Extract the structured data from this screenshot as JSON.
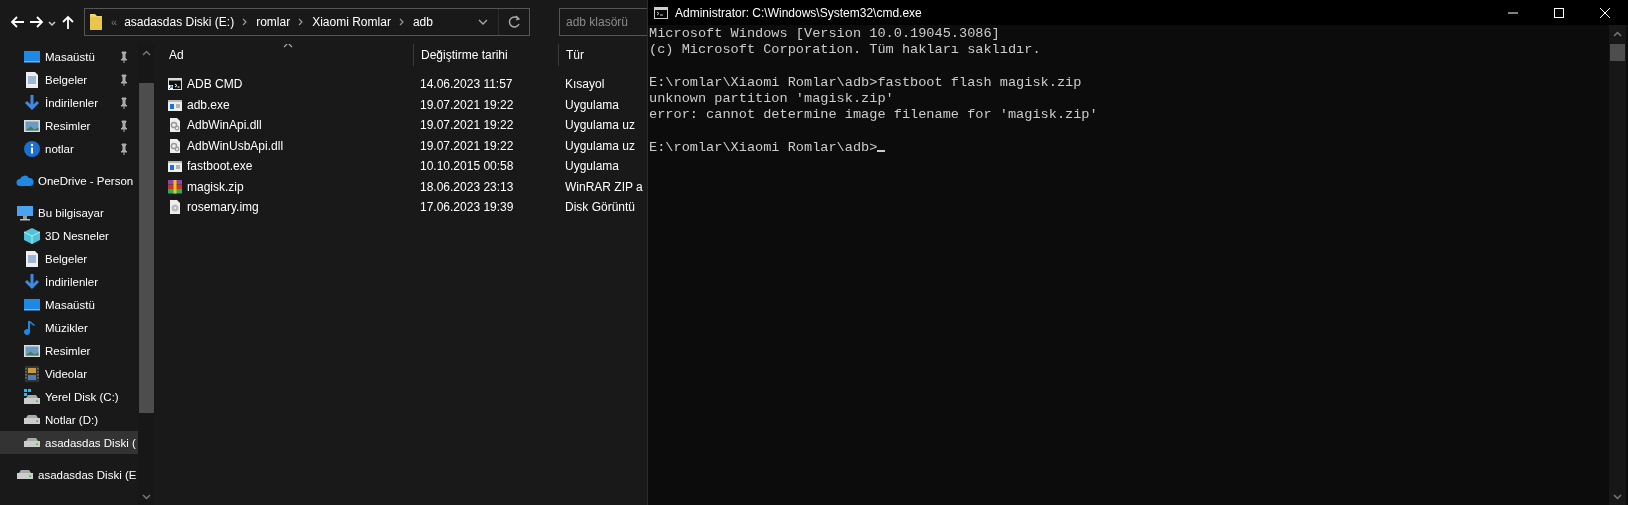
{
  "explorer": {
    "nav_buttons": [
      {
        "kind": "back"
      },
      {
        "kind": "forward"
      },
      {
        "kind": "recent"
      },
      {
        "kind": "up"
      }
    ],
    "address_bar": {
      "overflow": "«",
      "crumbs": [
        "asadasdas Diski (E:)",
        "romlar",
        "Xiaomi Romlar",
        "adb"
      ]
    },
    "search": {
      "placeholder": "adb klasörü"
    },
    "sidebar": {
      "quick_access": [
        {
          "label": "Masaüstü",
          "kind": "desktop",
          "pinned": true,
          "selected": false
        },
        {
          "label": "Belgeler",
          "kind": "documents",
          "pinned": true,
          "selected": false
        },
        {
          "label": "İndirilenler",
          "kind": "downloads",
          "pinned": true,
          "selected": false
        },
        {
          "label": "Resimler",
          "kind": "pictures",
          "pinned": true,
          "selected": false
        },
        {
          "label": "notlar",
          "kind": "info",
          "pinned": true,
          "selected": false
        }
      ],
      "tree": [
        {
          "label": "OneDrive - Person",
          "kind": "cloud",
          "selected": false
        },
        {
          "label": "Bu bilgisayar",
          "kind": "computer",
          "selected": false,
          "children": [
            {
              "label": "3D Nesneler",
              "kind": "cube",
              "selected": false
            },
            {
              "label": "Belgeler",
              "kind": "documents",
              "selected": false
            },
            {
              "label": "İndirilenler",
              "kind": "downloads",
              "selected": false
            },
            {
              "label": "Masaüstü",
              "kind": "desktop",
              "selected": false
            },
            {
              "label": "Müzikler",
              "kind": "music",
              "selected": false
            },
            {
              "label": "Resimler",
              "kind": "pictures",
              "selected": false
            },
            {
              "label": "Videolar",
              "kind": "video",
              "selected": false
            },
            {
              "label": "Yerel Disk (C:)",
              "kind": "system-disk",
              "selected": false
            },
            {
              "label": "Notlar  (D:)",
              "kind": "disk",
              "selected": false
            },
            {
              "label": "asadasdas Diski (",
              "kind": "disk",
              "selected": true
            }
          ]
        },
        {
          "label": "asadasdas Diski (E",
          "kind": "disk",
          "selected": false
        }
      ]
    },
    "table": {
      "columns": [
        "Ad",
        "Değiştirme tarihi",
        "Tür"
      ],
      "rows": [
        {
          "kind": "shortcut",
          "name": "ADB CMD",
          "date": "14.06.2023 11:57",
          "type": "Kısayol"
        },
        {
          "kind": "exe",
          "name": "adb.exe",
          "date": "19.07.2021 19:22",
          "type": "Uygulama"
        },
        {
          "kind": "dll",
          "name": "AdbWinApi.dll",
          "date": "19.07.2021 19:22",
          "type": "Uygulama uz"
        },
        {
          "kind": "dll",
          "name": "AdbWinUsbApi.dll",
          "date": "19.07.2021 19:22",
          "type": "Uygulama uz"
        },
        {
          "kind": "exe",
          "name": "fastboot.exe",
          "date": "10.10.2015 00:58",
          "type": "Uygulama"
        },
        {
          "kind": "archive",
          "name": "magisk.zip",
          "date": "18.06.2023 23:13",
          "type": "WinRAR ZIP a"
        },
        {
          "kind": "disk-image",
          "name": "rosemary.img",
          "date": "17.06.2023 19:39",
          "type": "Disk Görüntü"
        }
      ]
    }
  },
  "console": {
    "title": "Administrator: C:\\Windows\\System32\\cmd.exe",
    "blocks": [
      [
        "Microsoft Windows [Version 10.0.19045.3086]",
        "(c) Microsoft Corporation. Tüm hakları saklıdır."
      ],
      [
        "E:\\romlar\\Xiaomi Romlar\\adb>fastboot flash magisk.zip",
        "unknown partition 'magisk.zip'",
        "error: cannot determine image filename for 'magisk.zip'"
      ],
      [
        "E:\\romlar\\Xiaomi Romlar\\adb>"
      ]
    ],
    "cursor": true
  }
}
